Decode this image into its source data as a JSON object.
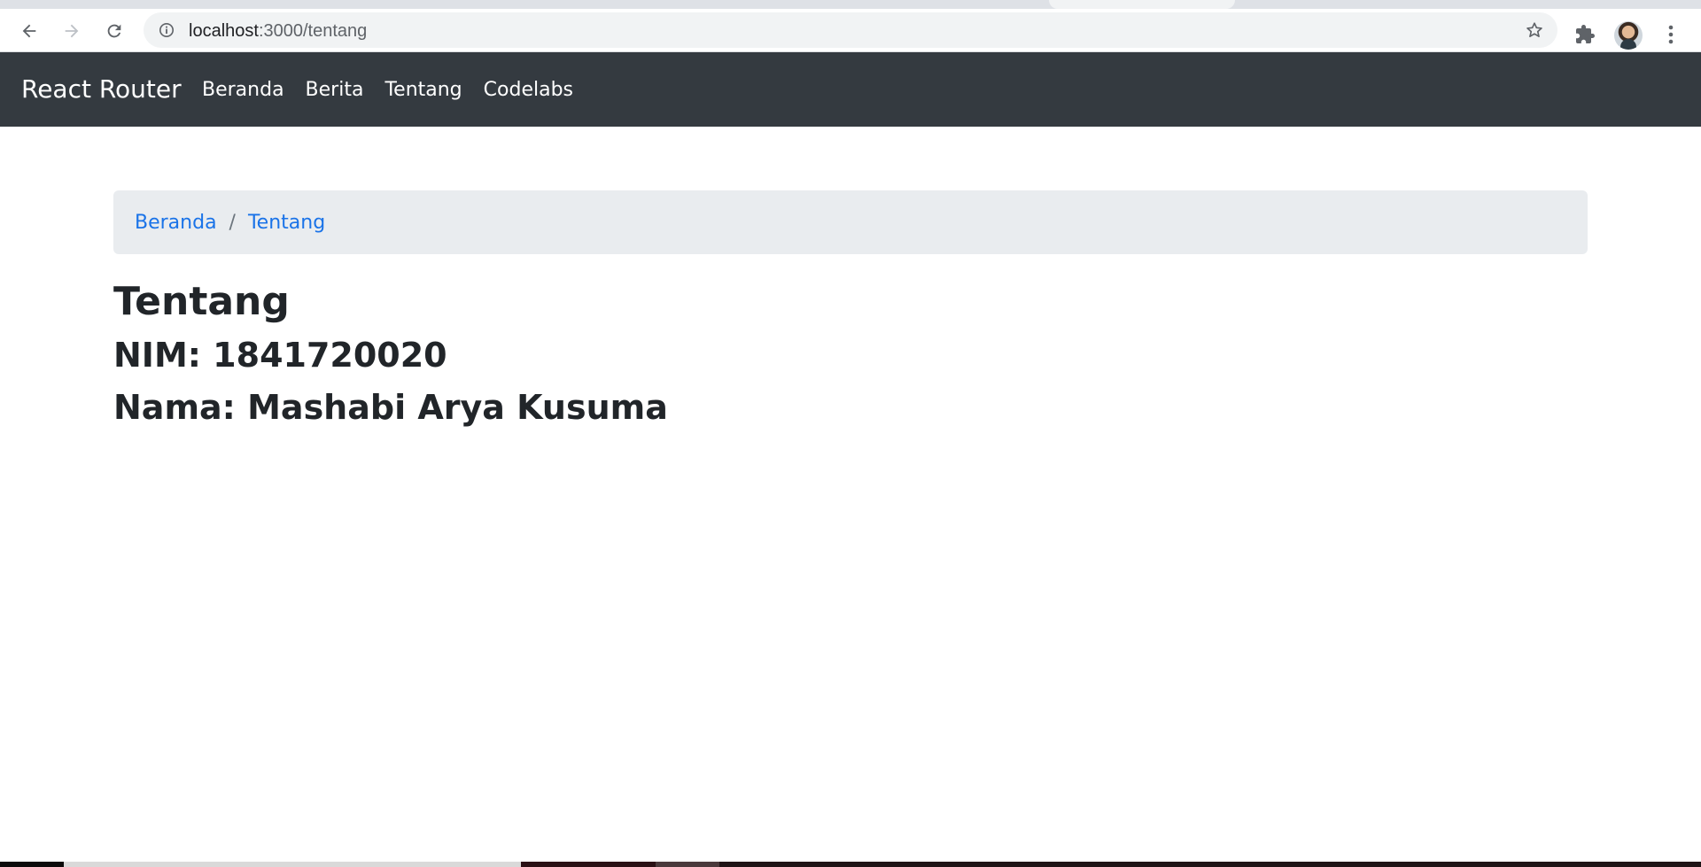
{
  "browser": {
    "url_host": "localhost",
    "url_path": ":3000/tentang",
    "icons": [
      "back-arrow-icon",
      "forward-arrow-icon",
      "reload-icon",
      "info-icon",
      "star-icon",
      "extensions-puzzle-icon",
      "kebab-menu-icon"
    ]
  },
  "navbar": {
    "brand": "React Router",
    "links": [
      "Beranda",
      "Berita",
      "Tentang",
      "Codelabs"
    ],
    "background": "#343a40"
  },
  "breadcrumb": {
    "items": [
      "Beranda",
      "Tentang"
    ],
    "separator": "/"
  },
  "content": {
    "title": "Tentang",
    "nim": "NIM: 1841720020",
    "nama": "Nama: Mashabi Arya Kusuma"
  },
  "colors": {
    "link": "#1a73e8",
    "text": "#212529",
    "breadcrumb_bg": "#e9ecef"
  }
}
